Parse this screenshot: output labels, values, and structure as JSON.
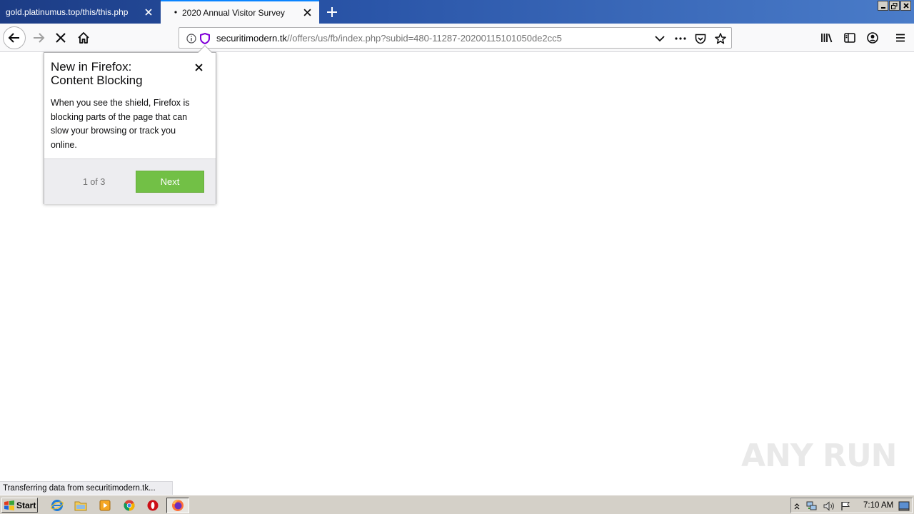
{
  "tabs": [
    {
      "title": "gold.platinumus.top/this/this.php",
      "active": false
    },
    {
      "title": "2020 Annual Visitor Survey",
      "active": true
    }
  ],
  "urlbar": {
    "host": "securitimodern.tk",
    "path": "//offers/us/fb/index.php?subid=480-11287-20200115101050de2cc5"
  },
  "popup": {
    "title_line1": "New in Firefox:",
    "title_line2": "Content Blocking",
    "body": "When you see the shield, Firefox is blocking parts of the page that can slow your browsing or track you online.",
    "step": "1 of 3",
    "next_label": "Next",
    "next_color": "#72c046"
  },
  "status": "Transferring data from securitimodern.tk...",
  "watermark": "ANY RUN",
  "taskbar": {
    "start_label": "Start",
    "clock": "7:10 AM"
  },
  "colors": {
    "tabstrip": "#2a55a8",
    "active_tab_accent": "#0a84ff",
    "shield": "#8000d7"
  }
}
